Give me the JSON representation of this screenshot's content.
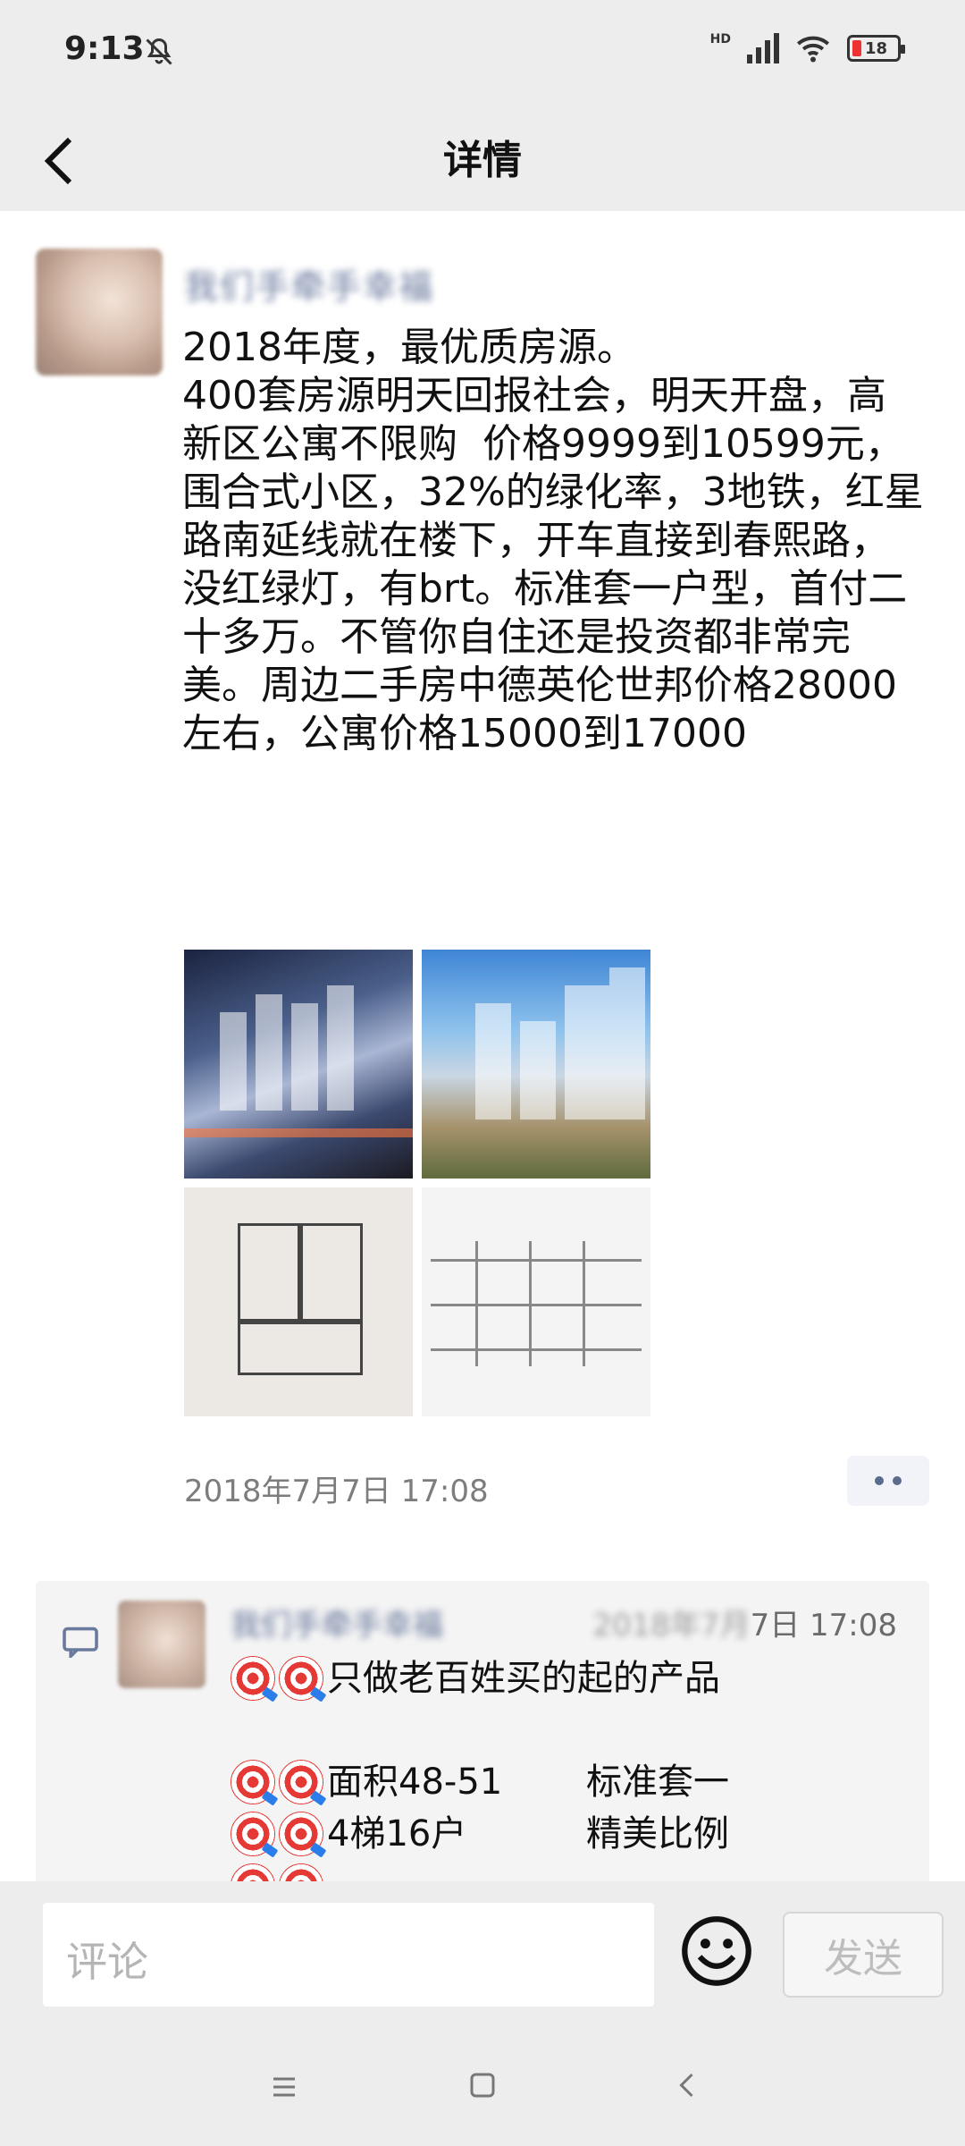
{
  "status_bar": {
    "time": "9:13",
    "network": "HD",
    "battery": "18"
  },
  "header": {
    "title": "详情"
  },
  "post": {
    "author": "我们手牵手幸福",
    "text": "2018年度，最优质房源。\n400套房源明天回报社会，明天开盘，高新区公寓不限购  价格9999到10599元，围合式小区，32%的绿化率，3地铁，红星路南延线就在楼下，开车直接到春熙路，没红绿灯，有brt。标准套一户型，首付二十多万。不管你自住还是投资都非常完美。周边二手房中德英伦世邦价格28000左右，公寓价格15000到17000",
    "photos": [
      "aerial-view",
      "building-view",
      "floor-plan",
      "layout-plan"
    ],
    "timestamp": "2018年7月7日 17:08"
  },
  "comments": [
    {
      "author": "我们手牵手幸福",
      "time_blurred": "2018年7月",
      "time": "7日 17:08",
      "lines": [
        {
          "a": "只做老百姓买的起的产品",
          "b": ""
        },
        {
          "a": "",
          "b": ""
        },
        {
          "a": "面积48-51",
          "b": "标准套一"
        },
        {
          "a": "4梯16户",
          "b": "精美比例"
        }
      ]
    }
  ],
  "comment_input": {
    "placeholder": "评论",
    "send_label": "发送"
  },
  "colors": {
    "bar_bg": "#ededed",
    "link_name": "#6a7a9e",
    "battery_low": "#e33"
  }
}
